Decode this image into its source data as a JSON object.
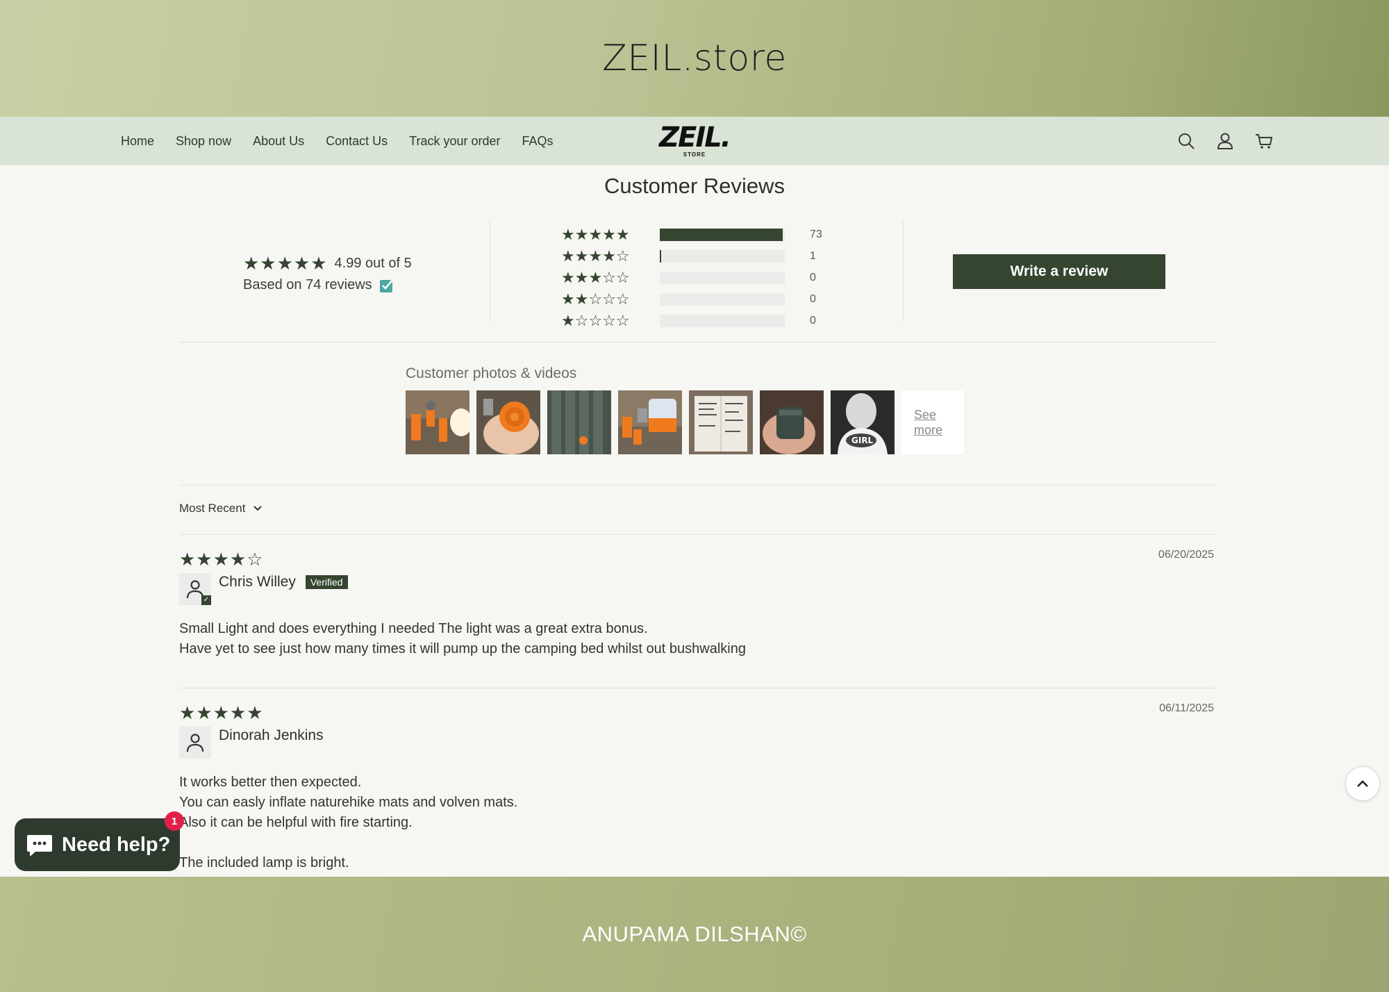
{
  "banner": {
    "title": "ZEIL.store"
  },
  "nav": {
    "links": [
      "Home",
      "Shop now",
      "About Us",
      "Contact Us",
      "Track your order",
      "FAQs"
    ],
    "logo_main": "ZEIL.",
    "logo_sub": "STORE",
    "icons": [
      "search-icon",
      "account-icon",
      "cart-icon"
    ]
  },
  "reviews": {
    "title": "Customer Reviews",
    "average_text": "4.99 out of 5",
    "average_rating": 4.99,
    "based_on": "Based on 74 reviews",
    "histogram": [
      {
        "stars": 5,
        "stars_text": "★★★★★",
        "count": "73",
        "fraction": 0.986
      },
      {
        "stars": 4,
        "stars_text": "★★★★☆",
        "count": "1",
        "fraction": 0.014
      },
      {
        "stars": 3,
        "stars_text": "★★★☆☆",
        "count": "0",
        "fraction": 0
      },
      {
        "stars": 2,
        "stars_text": "★★☆☆☆",
        "count": "0",
        "fraction": 0
      },
      {
        "stars": 1,
        "stars_text": "★☆☆☆☆",
        "count": "0",
        "fraction": 0
      }
    ],
    "write_review_label": "Write a review",
    "photos_title": "Customer photos & videos",
    "see_more": "See more",
    "sort_label": "Most Recent",
    "items": [
      {
        "rating": 4,
        "stars_text": "★★★★☆",
        "date": "06/20/2025",
        "author": "Chris Willey",
        "badge": "Verified",
        "body": "Small Light and does everything I needed The light was a great extra bonus.\nHave yet to see just how many times it will pump up the camping bed whilst out bushwalking"
      },
      {
        "rating": 5,
        "stars_text": "★★★★★",
        "date": "06/11/2025",
        "author": "Dinorah Jenkins",
        "body": "It works better then expected.\nYou can easly inflate naturehike mats and volven mats.\nAlso it can be helpful with fire starting.\n\nThe included lamp is bright."
      }
    ]
  },
  "chat": {
    "label": "Need help?",
    "badge_count": "1"
  },
  "footer": {
    "text": "ANUPAMA DILSHAN©"
  },
  "colors": {
    "accent": "#354530",
    "nav_bg": "#d9e4d6",
    "badge_red": "#e0204a"
  }
}
